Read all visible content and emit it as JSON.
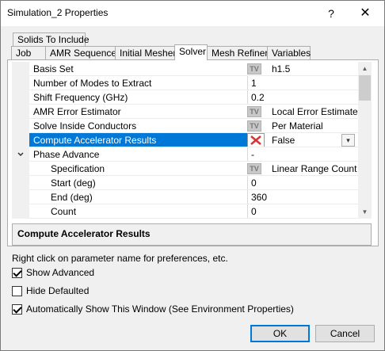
{
  "window": {
    "title": "Simulation_2 Properties",
    "help": "?",
    "close": "✕"
  },
  "tabs_back": [
    {
      "label": "Solids To Include"
    }
  ],
  "tabs_front": [
    {
      "label": "Job"
    },
    {
      "label": "AMR Sequence"
    },
    {
      "label": "Initial Mesher"
    },
    {
      "label": "Solver",
      "active": true
    },
    {
      "label": "Mesh Refiner"
    },
    {
      "label": "Variables"
    }
  ],
  "rows": [
    {
      "name": "Basis Set",
      "value": "h1.5",
      "control": "tv"
    },
    {
      "name": "Number of Modes to Extract",
      "value": "1"
    },
    {
      "name": "Shift Frequency (GHz)",
      "value": "0.2"
    },
    {
      "name": "AMR Error Estimator",
      "value": "Local Error Estimate",
      "control": "tv"
    },
    {
      "name": "Solve Inside Conductors",
      "value": "Per Material",
      "control": "tv"
    },
    {
      "name": "Compute Accelerator Results",
      "value": "False",
      "control": "x",
      "selected": true
    },
    {
      "name": "Phase Advance",
      "value": "-",
      "group": true
    },
    {
      "name": "Specification",
      "value": "Linear Range Count",
      "control": "tv",
      "indent": true
    },
    {
      "name": "Start (deg)",
      "value": "0",
      "indent": true
    },
    {
      "name": "End (deg)",
      "value": "360",
      "indent": true
    },
    {
      "name": "Count",
      "value": "0",
      "indent": true
    }
  ],
  "tv_label": "TV",
  "description": "Compute Accelerator Results",
  "hint": "Right click on parameter name for preferences, etc.",
  "checkboxes": [
    {
      "label": "Show Advanced",
      "checked": true
    },
    {
      "label": "Hide Defaulted",
      "checked": false
    },
    {
      "label": "Automatically Show This Window (See Environment Properties)",
      "checked": true
    }
  ],
  "buttons": {
    "ok": "OK",
    "cancel": "Cancel"
  }
}
